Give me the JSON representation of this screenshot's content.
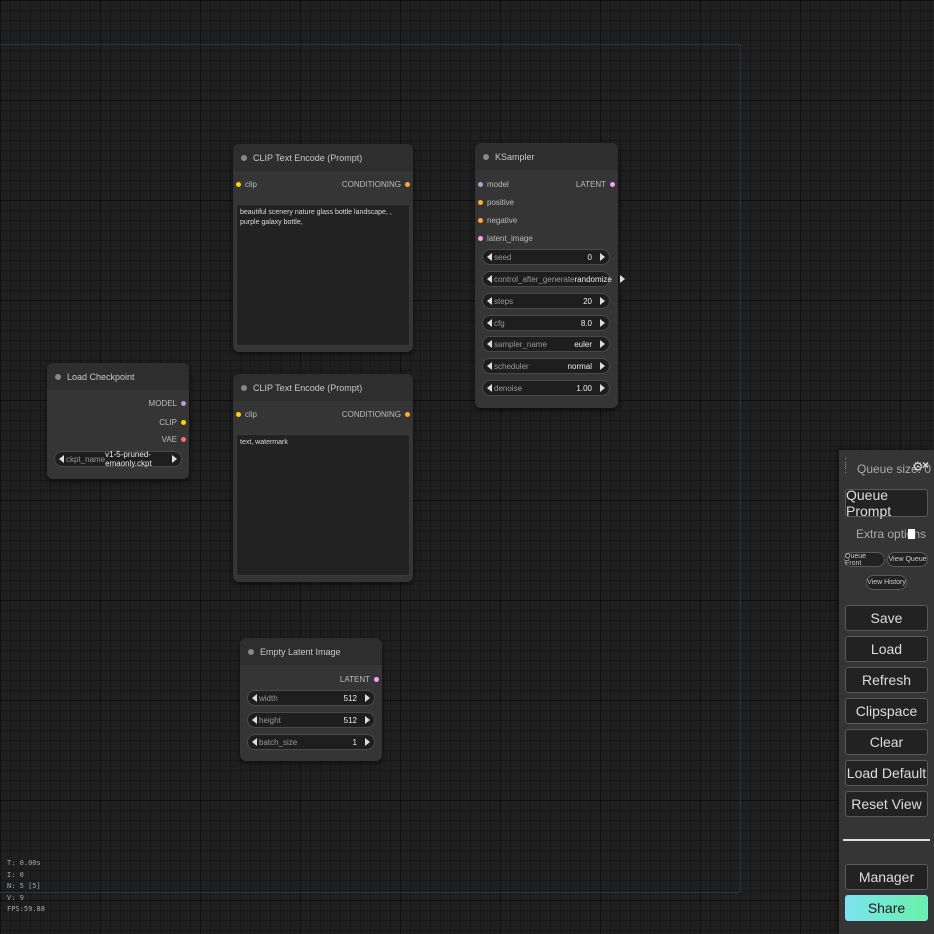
{
  "nodes": {
    "clip1": {
      "title": "CLIP Text Encode (Prompt)",
      "input": "clip",
      "output": "CONDITIONING",
      "text": "beautiful scenery nature glass bottle landscape, , purple galaxy bottle,"
    },
    "clip2": {
      "title": "CLIP Text Encode (Prompt)",
      "input": "clip",
      "output": "CONDITIONING",
      "text": "text, watermark"
    },
    "ksampler": {
      "title": "KSampler",
      "inputs": [
        "model",
        "positive",
        "negative",
        "latent_image"
      ],
      "output": "LATENT",
      "widgets": [
        {
          "name": "seed",
          "value": "0"
        },
        {
          "name": "control_after_generate",
          "value": "randomize"
        },
        {
          "name": "steps",
          "value": "20"
        },
        {
          "name": "cfg",
          "value": "8.0"
        },
        {
          "name": "sampler_name",
          "value": "euler"
        },
        {
          "name": "scheduler",
          "value": "normal"
        },
        {
          "name": "denoise",
          "value": "1.00"
        }
      ]
    },
    "checkpoint": {
      "title": "Load Checkpoint",
      "outputs": [
        "MODEL",
        "CLIP",
        "VAE"
      ],
      "widget": {
        "name": "ckpt_name",
        "value": "v1-5-pruned-emaonly.ckpt"
      }
    },
    "latent": {
      "title": "Empty Latent Image",
      "output": "LATENT",
      "widgets": [
        {
          "name": "width",
          "value": "512"
        },
        {
          "name": "height",
          "value": "512"
        },
        {
          "name": "batch_size",
          "value": "1"
        }
      ]
    }
  },
  "stats": {
    "t": "T: 0.00s",
    "i": "I: 0",
    "n": "N: 5 [5]",
    "v": "V: 9",
    "fps": "FPS:59.88"
  },
  "menu": {
    "queue_size": "Queue size: 0",
    "queue_prompt": "Queue Prompt",
    "extra_options": "Extra options",
    "queue_front": "Queue Front",
    "view_queue": "View Queue",
    "view_history": "View History",
    "save": "Save",
    "load": "Load",
    "refresh": "Refresh",
    "clipspace": "Clipspace",
    "clear": "Clear",
    "load_default": "Load Default",
    "reset_view": "Reset View",
    "manager": "Manager",
    "share": "Share"
  },
  "colors": {
    "clip_slot": "#ffd500",
    "model_slot": "#b39ddb",
    "conditioning_slot": "#ffa931",
    "latent_slot": "#ff9cf9",
    "vae_slot": "#ff6e6e",
    "share_gradient_start": "#7de3f0",
    "share_gradient_end": "#68f0a8"
  }
}
